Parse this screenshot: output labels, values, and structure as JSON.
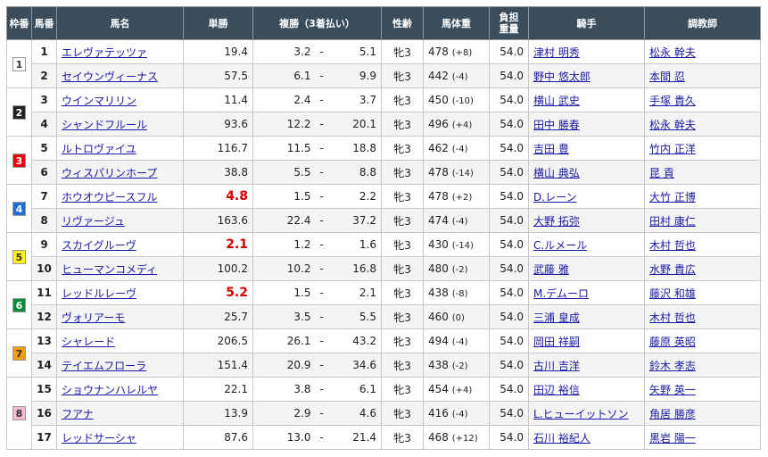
{
  "headers": {
    "gate": "枠番",
    "num": "馬番",
    "horse": "馬名",
    "win": "単勝",
    "place": "複勝（3着払い）",
    "sex": "性齢",
    "weight": "馬体重",
    "burden_1": "負担",
    "burden_2": "重量",
    "jockey": "騎手",
    "trainer": "調教師"
  },
  "gate_colors": {
    "1": {
      "bg": "#ffffff",
      "fg": "#333333"
    },
    "2": {
      "bg": "#222222",
      "fg": "#ffffff"
    },
    "3": {
      "bg": "#e60012",
      "fg": "#ffffff"
    },
    "4": {
      "bg": "#1d6fd4",
      "fg": "#ffffff"
    },
    "5": {
      "bg": "#fff21a",
      "fg": "#333333"
    },
    "6": {
      "bg": "#0a8a3a",
      "fg": "#ffffff"
    },
    "7": {
      "bg": "#f59a16",
      "fg": "#333333"
    },
    "8": {
      "bg": "#f7b9d1",
      "fg": "#333333"
    }
  },
  "rows": [
    {
      "gate": "1",
      "num": "1",
      "horse": "エレヴァテッツァ",
      "win": "19.4",
      "fav": false,
      "place_low": "3.2",
      "place_high": "5.1",
      "sex": "牝3",
      "weight": "478",
      "change": "(+8)",
      "burden": "54.0",
      "jockey": "津村 明秀",
      "trainer": "松永 幹夫"
    },
    {
      "gate": "1",
      "num": "2",
      "horse": "セイウンヴィーナス",
      "win": "57.5",
      "fav": false,
      "place_low": "6.1",
      "place_high": "9.9",
      "sex": "牝3",
      "weight": "442",
      "change": "(-4)",
      "burden": "54.0",
      "jockey": "野中 悠太郎",
      "trainer": "本間 忍"
    },
    {
      "gate": "2",
      "num": "3",
      "horse": "ウインマリリン",
      "win": "11.4",
      "fav": false,
      "place_low": "2.4",
      "place_high": "3.7",
      "sex": "牝3",
      "weight": "450",
      "change": "(-10)",
      "burden": "54.0",
      "jockey": "横山 武史",
      "trainer": "手塚 貴久"
    },
    {
      "gate": "2",
      "num": "4",
      "horse": "シャンドフルール",
      "win": "93.6",
      "fav": false,
      "place_low": "12.2",
      "place_high": "20.1",
      "sex": "牝3",
      "weight": "496",
      "change": "(+4)",
      "burden": "54.0",
      "jockey": "田中 勝春",
      "trainer": "松永 幹夫"
    },
    {
      "gate": "3",
      "num": "5",
      "horse": "ルトロヴァイユ",
      "win": "116.7",
      "fav": false,
      "place_low": "11.5",
      "place_high": "18.8",
      "sex": "牝3",
      "weight": "462",
      "change": "(-4)",
      "burden": "54.0",
      "jockey": "吉田 豊",
      "trainer": "竹内 正洋"
    },
    {
      "gate": "3",
      "num": "6",
      "horse": "ウィスパリンホープ",
      "win": "38.8",
      "fav": false,
      "place_low": "5.5",
      "place_high": "8.8",
      "sex": "牝3",
      "weight": "478",
      "change": "(-14)",
      "burden": "54.0",
      "jockey": "横山 典弘",
      "trainer": "昆 貢"
    },
    {
      "gate": "4",
      "num": "7",
      "horse": "ホウオウピースフル",
      "win": "4.8",
      "fav": true,
      "place_low": "1.5",
      "place_high": "2.2",
      "sex": "牝3",
      "weight": "478",
      "change": "(+2)",
      "burden": "54.0",
      "jockey": "D.レーン",
      "trainer": "大竹 正博"
    },
    {
      "gate": "4",
      "num": "8",
      "horse": "リヴァージュ",
      "win": "163.6",
      "fav": false,
      "place_low": "22.4",
      "place_high": "37.2",
      "sex": "牝3",
      "weight": "474",
      "change": "(-4)",
      "burden": "54.0",
      "jockey": "大野 拓弥",
      "trainer": "田村 康仁"
    },
    {
      "gate": "5",
      "num": "9",
      "horse": "スカイグルーヴ",
      "win": "2.1",
      "fav": true,
      "place_low": "1.2",
      "place_high": "1.6",
      "sex": "牝3",
      "weight": "430",
      "change": "(-14)",
      "burden": "54.0",
      "jockey": "C.ルメール",
      "trainer": "木村 哲也"
    },
    {
      "gate": "5",
      "num": "10",
      "horse": "ヒューマンコメディ",
      "win": "100.2",
      "fav": false,
      "place_low": "10.2",
      "place_high": "16.8",
      "sex": "牝3",
      "weight": "480",
      "change": "(-2)",
      "burden": "54.0",
      "jockey": "武藤 雅",
      "trainer": "水野 貴広"
    },
    {
      "gate": "6",
      "num": "11",
      "horse": "レッドルレーヴ",
      "win": "5.2",
      "fav": true,
      "place_low": "1.5",
      "place_high": "2.1",
      "sex": "牝3",
      "weight": "438",
      "change": "(-8)",
      "burden": "54.0",
      "jockey": "M.デムーロ",
      "trainer": "藤沢 和雄"
    },
    {
      "gate": "6",
      "num": "12",
      "horse": "ヴォリアーモ",
      "win": "25.7",
      "fav": false,
      "place_low": "3.5",
      "place_high": "5.5",
      "sex": "牝3",
      "weight": "460",
      "change": "(0)",
      "burden": "54.0",
      "jockey": "三浦 皇成",
      "trainer": "木村 哲也"
    },
    {
      "gate": "7",
      "num": "13",
      "horse": "シャレード",
      "win": "206.5",
      "fav": false,
      "place_low": "26.1",
      "place_high": "43.2",
      "sex": "牝3",
      "weight": "494",
      "change": "(-4)",
      "burden": "54.0",
      "jockey": "岡田 祥嗣",
      "trainer": "藤原 英昭"
    },
    {
      "gate": "7",
      "num": "14",
      "horse": "テイエムフローラ",
      "win": "151.4",
      "fav": false,
      "place_low": "20.9",
      "place_high": "34.6",
      "sex": "牝3",
      "weight": "438",
      "change": "(-2)",
      "burden": "54.0",
      "jockey": "古川 吉洋",
      "trainer": "鈴木 孝志"
    },
    {
      "gate": "8",
      "num": "15",
      "horse": "ショウナンハレルヤ",
      "win": "22.1",
      "fav": false,
      "place_low": "3.8",
      "place_high": "6.1",
      "sex": "牝3",
      "weight": "454",
      "change": "(+4)",
      "burden": "54.0",
      "jockey": "田辺 裕信",
      "trainer": "矢野 英一"
    },
    {
      "gate": "8",
      "num": "16",
      "horse": "フアナ",
      "win": "13.9",
      "fav": false,
      "place_low": "2.9",
      "place_high": "4.6",
      "sex": "牝3",
      "weight": "416",
      "change": "(-4)",
      "burden": "54.0",
      "jockey": "L.ヒューイットソン",
      "trainer": "角居 勝彦"
    },
    {
      "gate": "8",
      "num": "17",
      "horse": "レッドサーシャ",
      "win": "87.6",
      "fav": false,
      "place_low": "13.0",
      "place_high": "21.4",
      "sex": "牝3",
      "weight": "468",
      "change": "(+12)",
      "burden": "54.0",
      "jockey": "石川 裕紀人",
      "trainer": "黒岩 陽一"
    }
  ]
}
